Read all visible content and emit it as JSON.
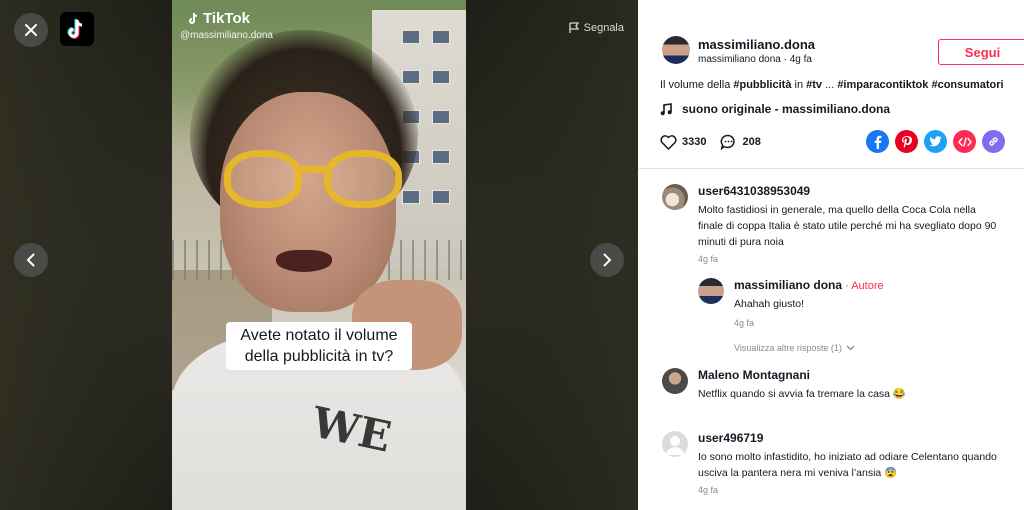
{
  "video": {
    "report_label": "Segnala",
    "watermark_brand": "TikTok",
    "watermark_user": "@massimiliano.dona",
    "caption": "Avete notato il volume della pubblicità in tv?",
    "shirt_print": "WE"
  },
  "author": {
    "username": "massimiliano.dona",
    "meta": "massimiliano dona · 4g fa",
    "follow_label": "Segui"
  },
  "description": {
    "prefix": "Il volume della ",
    "tag1": "#pubblicità",
    "mid1": " in ",
    "tag2": "#tv",
    "mid2": " ... ",
    "tag3": "#imparacontiktok",
    "mid3": " ",
    "tag4": "#consumatori"
  },
  "music": "suono originale - massimiliano.dona",
  "stats": {
    "likes": "3330",
    "comments": "208"
  },
  "share_icons": [
    "facebook-icon",
    "pinterest-icon",
    "twitter-icon",
    "embed-icon",
    "link-icon"
  ],
  "colors": {
    "accent": "#fe2c55",
    "facebook": "#1877f2",
    "pinterest": "#e60023",
    "twitter": "#1da1f2",
    "embed": "#fe2c55",
    "link": "#7f6ded"
  },
  "comments": [
    {
      "user": "user6431038953049",
      "text": "Molto fastidiosi in generale, ma quello della Coca Cola nella finale di coppa Italia è stato utile perché mi ha svegliato dopo 90 minuti di pura noia",
      "time": "4g fa"
    },
    {
      "user": "massimiliano dona",
      "author_tag": " · Autore",
      "text": "Ahahah giusto!",
      "time": "4g fa"
    },
    {
      "user": "Maleno Montagnani",
      "text": "Netflix quando si avvia fa tremare la casa 😂"
    },
    {
      "user": "user496719",
      "text": "Io sono molto infastidito, ho iniziato ad odiare Celentano quando usciva la pantera nera mi veniva l’ansia 😨",
      "time": "4g fa"
    }
  ],
  "view_replies_label": "Visualizza altre risposte (1)"
}
